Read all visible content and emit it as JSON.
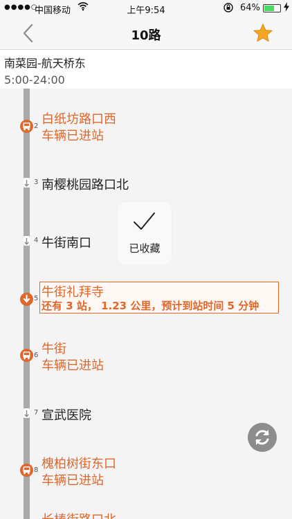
{
  "status_bar": {
    "signal": "●●●●○",
    "carrier": "中国移动",
    "time": "上午9:54",
    "battery": "64%",
    "battery_fraction": 0.64
  },
  "nav": {
    "title": "10路",
    "back_icon": "chevron-left-icon",
    "favorite_icon": "star-icon",
    "accent": "#f5a623"
  },
  "route": {
    "name": "南菜园-航天桥东",
    "hours": "5:00-24:00"
  },
  "stops": [
    {
      "num": "2",
      "name": "白纸坊路口西",
      "status": "车辆已进站",
      "icon": "bus-icon"
    },
    {
      "num": "3",
      "name": "南樱桃园路口北",
      "icon": "arrow-down-icon"
    },
    {
      "num": "4",
      "name": "牛街南口",
      "icon": "arrow-down-icon"
    },
    {
      "num": "5",
      "name": "牛街礼拜寺",
      "status": "还有 3 站， 1.23 公里，预计到站时间 5 分钟",
      "icon": "location-pin-icon"
    },
    {
      "num": "6",
      "name": "牛街",
      "status": "车辆已进站",
      "icon": "bus-icon"
    },
    {
      "num": "7",
      "name": "宣武医院",
      "icon": "arrow-down-icon"
    },
    {
      "num": "8",
      "name": "槐柏树街东口",
      "status": "车辆已进站",
      "icon": "bus-icon"
    },
    {
      "name": "长椿街路口北"
    }
  ],
  "toast": {
    "message": "已收藏",
    "icon": "checkmark-icon"
  },
  "refresh": {
    "icon": "refresh-icon"
  },
  "colors": {
    "orange": "#e0662a",
    "track": "#a9a9a9",
    "star": "#f5a623"
  }
}
